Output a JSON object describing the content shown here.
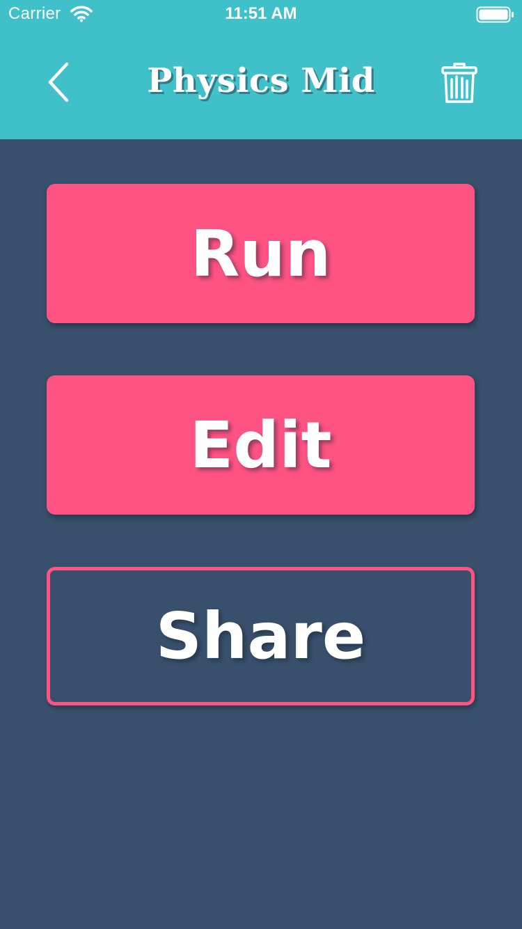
{
  "status_bar": {
    "carrier": "Carrier",
    "time": "11:51 AM",
    "wifi_icon": "wifi-icon",
    "battery_icon": "battery-full-icon"
  },
  "nav": {
    "title": "Physics Mid",
    "back_icon": "chevron-left-icon",
    "delete_icon": "trash-icon"
  },
  "actions": {
    "run_label": "Run",
    "edit_label": "Edit",
    "share_label": "Share"
  },
  "colors": {
    "header": "#40c1c9",
    "background": "#38506b",
    "accent": "#ff5383",
    "text": "#ffffff"
  }
}
